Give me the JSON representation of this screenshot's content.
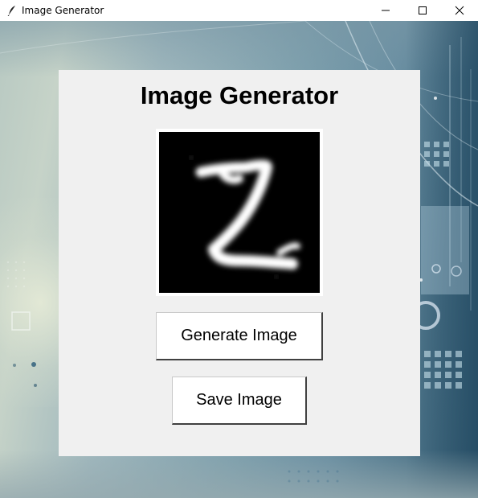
{
  "window": {
    "title": "Image Generator",
    "app_icon": "feather-icon",
    "controls": [
      "minimize-icon",
      "maximize-icon",
      "close-icon"
    ]
  },
  "main": {
    "heading": "Image Generator",
    "generated_image": {
      "description_icon": "generated-digit-image"
    },
    "buttons": {
      "generate_label": "Generate Image",
      "save_label": "Save Image"
    }
  },
  "colors": {
    "panel_bg": "#f0f0f0",
    "button_bg": "#ffffff",
    "image_bg": "#000000",
    "digit": "#ffffff"
  }
}
